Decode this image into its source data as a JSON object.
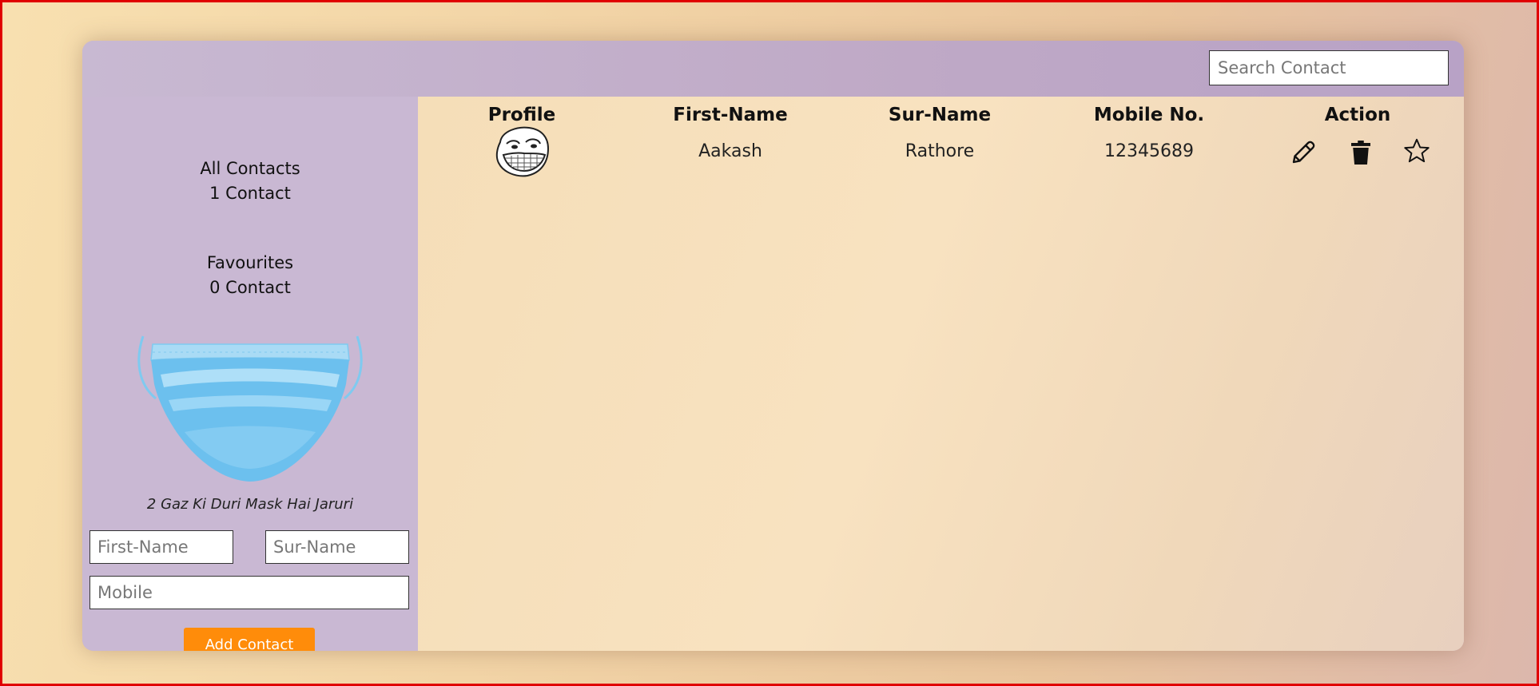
{
  "search": {
    "placeholder": "Search Contact"
  },
  "sidebar": {
    "all_contacts_label": "All Contacts",
    "all_contacts_count": "1 Contact",
    "favourites_label": "Favourites",
    "favourites_count": "0 Contact",
    "image_icon": "face-mask-icon",
    "slogan": "2 Gaz Ki Duri Mask Hai Jaruri"
  },
  "form": {
    "first_name_placeholder": "First-Name",
    "sur_name_placeholder": "Sur-Name",
    "mobile_placeholder": "Mobile",
    "add_button_label": "Add Contact"
  },
  "table": {
    "headers": [
      "Profile",
      "First-Name",
      "Sur-Name",
      "Mobile No.",
      "Action"
    ],
    "rows": [
      {
        "profile_icon": "troll-face-avatar",
        "first_name": "Aakash",
        "sur_name": "Rathore",
        "mobile": "12345689",
        "actions": [
          "edit-icon",
          "delete-icon",
          "star-icon"
        ]
      }
    ]
  },
  "colors": {
    "accent": "#ff8c0a",
    "sidebar": "#c9b8d3",
    "page_border": "#e00000"
  }
}
